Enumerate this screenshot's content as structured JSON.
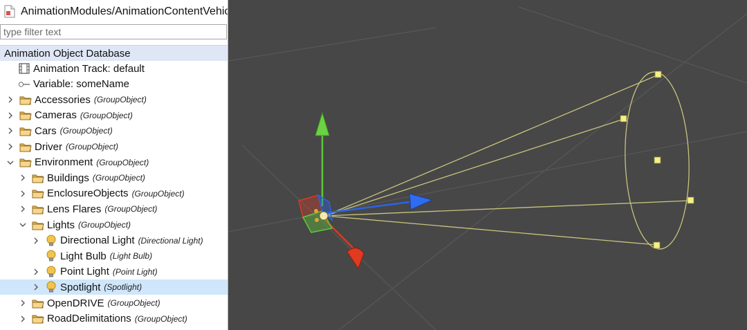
{
  "window": {
    "title": "AnimationModules/AnimationContentVehicle"
  },
  "filter": {
    "placeholder": "type filter text"
  },
  "tree": {
    "header": "Animation Object Database",
    "items": [
      {
        "label": "Animation Track: default",
        "type": "",
        "icon": "film-track-icon",
        "depth": 0,
        "expander": "none"
      },
      {
        "label": "Variable: someName",
        "type": "",
        "icon": "variable-key-icon",
        "depth": 0,
        "expander": "none"
      },
      {
        "label": "Accessories",
        "type": "(GroupObject)",
        "icon": "folder-icon",
        "depth": 0,
        "expander": "collapsed"
      },
      {
        "label": "Cameras",
        "type": "(GroupObject)",
        "icon": "folder-icon",
        "depth": 0,
        "expander": "collapsed"
      },
      {
        "label": "Cars",
        "type": "(GroupObject)",
        "icon": "folder-icon",
        "depth": 0,
        "expander": "collapsed"
      },
      {
        "label": "Driver",
        "type": "(GroupObject)",
        "icon": "folder-icon",
        "depth": 0,
        "expander": "collapsed"
      },
      {
        "label": "Environment",
        "type": "(GroupObject)",
        "icon": "folder-icon",
        "depth": 0,
        "expander": "expanded"
      },
      {
        "label": "Buildings",
        "type": "(GroupObject)",
        "icon": "folder-icon",
        "depth": 1,
        "expander": "collapsed"
      },
      {
        "label": "EnclosureObjects",
        "type": "(GroupObject)",
        "icon": "folder-icon",
        "depth": 1,
        "expander": "collapsed"
      },
      {
        "label": "Lens Flares",
        "type": "(GroupObject)",
        "icon": "folder-icon",
        "depth": 1,
        "expander": "collapsed"
      },
      {
        "label": "Lights",
        "type": "(GroupObject)",
        "icon": "folder-icon",
        "depth": 1,
        "expander": "expanded"
      },
      {
        "label": "Directional Light",
        "type": "(Directional Light)",
        "icon": "light-bulb-icon",
        "depth": 2,
        "expander": "collapsed"
      },
      {
        "label": "Light Bulb",
        "type": "(Light Bulb)",
        "icon": "light-bulb-icon",
        "depth": 2,
        "expander": "none"
      },
      {
        "label": "Point Light",
        "type": "(Point Light)",
        "icon": "light-bulb-icon",
        "depth": 2,
        "expander": "collapsed"
      },
      {
        "label": "Spotlight",
        "type": "(Spotlight)",
        "icon": "light-bulb-icon",
        "depth": 2,
        "expander": "collapsed",
        "selected": true
      },
      {
        "label": "OpenDRIVE",
        "type": "(GroupObject)",
        "icon": "folder-icon",
        "depth": 1,
        "expander": "collapsed"
      },
      {
        "label": "RoadDelimitations",
        "type": "(GroupObject)",
        "icon": "folder-icon",
        "depth": 1,
        "expander": "collapsed"
      }
    ]
  },
  "viewport": {
    "gizmo": {
      "y_axis_color": "#5fc83a",
      "z_axis_color": "#2b64e6",
      "x_axis_color": "#e0381f"
    },
    "spotlight_cone_color": "#c9c47d",
    "handle_color": "#f5f087",
    "background": "#474747"
  }
}
